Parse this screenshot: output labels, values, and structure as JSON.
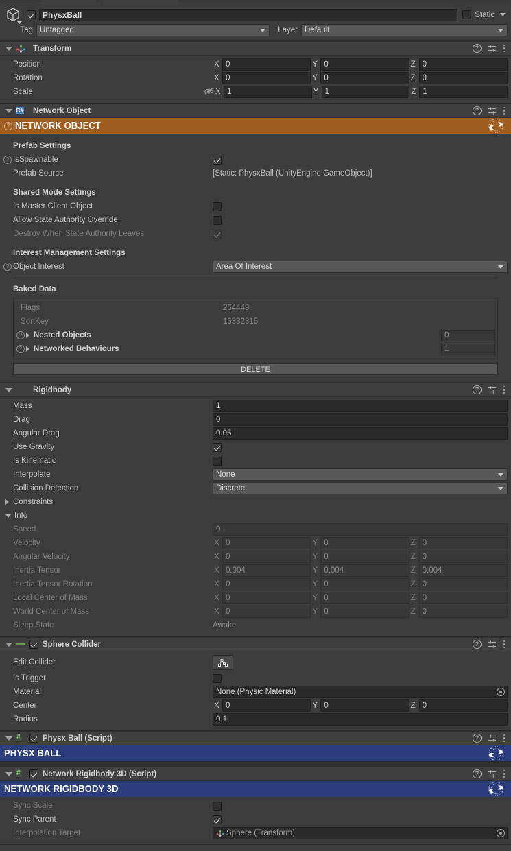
{
  "object_header": {
    "enabled": true,
    "name": "PhysxBall",
    "static_label": "Static",
    "static_checked": false,
    "tag_label": "Tag",
    "tag_value": "Untagged",
    "layer_label": "Layer",
    "layer_value": "Default"
  },
  "transform": {
    "title": "Transform",
    "rows": [
      {
        "label": "Position",
        "x": "0",
        "y": "0",
        "z": "0"
      },
      {
        "label": "Rotation",
        "x": "0",
        "y": "0",
        "z": "0"
      },
      {
        "label": "Scale",
        "x": "1",
        "y": "1",
        "z": "1"
      }
    ]
  },
  "network_object": {
    "title": "Network Object",
    "banner": "NETWORK OBJECT",
    "banner_color": "#a05d20",
    "prefab_settings_label": "Prefab Settings",
    "is_spawnable_label": "IsSpawnable",
    "is_spawnable_checked": true,
    "prefab_source_label": "Prefab Source",
    "prefab_source_value": "[Static: PhysxBall (UnityEngine.GameObject)]",
    "shared_mode_label": "Shared Mode Settings",
    "is_master_client_label": "Is Master Client Object",
    "is_master_client_checked": false,
    "allow_state_authority_label": "Allow State Authority Override",
    "allow_state_authority_checked": false,
    "destroy_when_leaves_label": "Destroy When State Authority Leaves",
    "destroy_when_leaves_checked": true,
    "interest_settings_label": "Interest Management Settings",
    "object_interest_label": "Object Interest",
    "object_interest_value": "Area Of Interest",
    "baked_data_label": "Baked Data",
    "flags_label": "Flags",
    "flags_value": "264449",
    "sortkey_label": "SortKey",
    "sortkey_value": "16332315",
    "nested_objects_label": "Nested Objects",
    "nested_objects_count": "0",
    "networked_behaviours_label": "Networked Behaviours",
    "networked_behaviours_count": "1",
    "delete_label": "DELETE"
  },
  "rigidbody": {
    "title": "Rigidbody",
    "mass_label": "Mass",
    "mass_value": "1",
    "drag_label": "Drag",
    "drag_value": "0",
    "angular_drag_label": "Angular Drag",
    "angular_drag_value": "0.05",
    "use_gravity_label": "Use Gravity",
    "use_gravity_checked": true,
    "is_kinematic_label": "Is Kinematic",
    "is_kinematic_checked": false,
    "interpolate_label": "Interpolate",
    "interpolate_value": "None",
    "collision_detection_label": "Collision Detection",
    "collision_detection_value": "Discrete",
    "constraints_label": "Constraints",
    "info_label": "Info",
    "speed_label": "Speed",
    "speed_value": "0",
    "info_rows": [
      {
        "label": "Velocity",
        "x": "0",
        "y": "0",
        "z": "0"
      },
      {
        "label": "Angular Velocity",
        "x": "0",
        "y": "0",
        "z": "0"
      },
      {
        "label": "Inertia Tensor",
        "x": "0.004",
        "y": "0.004",
        "z": "0.004"
      },
      {
        "label": "Inertia Tensor Rotation",
        "x": "0",
        "y": "0",
        "z": "0"
      },
      {
        "label": "Local Center of Mass",
        "x": "0",
        "y": "0",
        "z": "0"
      },
      {
        "label": "World Center of Mass",
        "x": "0",
        "y": "0",
        "z": "0"
      }
    ],
    "sleep_state_label": "Sleep State",
    "sleep_state_value": "Awake"
  },
  "sphere_collider": {
    "title": "Sphere Collider",
    "enabled": true,
    "edit_collider_label": "Edit Collider",
    "is_trigger_label": "Is Trigger",
    "is_trigger_checked": false,
    "material_label": "Material",
    "material_value": "None (Physic Material)",
    "center_label": "Center",
    "center_x": "0",
    "center_y": "0",
    "center_z": "0",
    "radius_label": "Radius",
    "radius_value": "0.1"
  },
  "physx_ball": {
    "title": "Physx Ball (Script)",
    "enabled": true,
    "banner": "PHYSX BALL",
    "banner_color": "#2b3d7d"
  },
  "network_rigidbody": {
    "title": "Network Rigidbody 3D (Script)",
    "enabled": true,
    "banner": "NETWORK RIGIDBODY 3D",
    "banner_color": "#2b3d7d",
    "sync_scale_label": "Sync Scale",
    "sync_scale_checked": false,
    "sync_parent_label": "Sync Parent",
    "sync_parent_checked": true,
    "interpolation_target_label": "Interpolation Target",
    "interpolation_target_value": "Sphere (Transform)"
  }
}
